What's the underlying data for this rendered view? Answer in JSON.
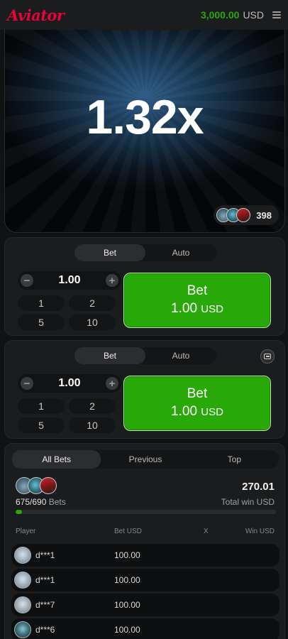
{
  "header": {
    "logo_text": "Aviator",
    "balance_amount": "3,000.00",
    "balance_currency": "USD",
    "menu_icon": "hamburger-menu-icon"
  },
  "game": {
    "multiplier": "1.32x",
    "players_online": "398"
  },
  "bet_panels": [
    {
      "tabs": [
        "Bet",
        "Auto"
      ],
      "active_tab": "Bet",
      "amount": "1.00",
      "quick_amounts": [
        "1",
        "2",
        "5",
        "10"
      ],
      "button_label": "Bet",
      "button_amount": "1.00",
      "button_currency": "USD"
    },
    {
      "tabs": [
        "Bet",
        "Auto"
      ],
      "active_tab": "Bet",
      "amount": "1.00",
      "quick_amounts": [
        "1",
        "2",
        "5",
        "10"
      ],
      "button_label": "Bet",
      "button_amount": "1.00",
      "button_currency": "USD",
      "remove_icon": "minus-box-icon"
    }
  ],
  "bets": {
    "tabs": [
      "All Bets",
      "Previous",
      "Top"
    ],
    "active_tab": "All Bets",
    "bets_count": "675/690",
    "bets_label": "Bets",
    "total_win": "270.01",
    "total_win_label": "Total win USD",
    "progress_percent": 2.5,
    "columns": [
      "Player",
      "Bet USD",
      "X",
      "Win USD"
    ],
    "rows": [
      {
        "player": "d***1",
        "bet": "100.00"
      },
      {
        "player": "d***1",
        "bet": "100.00"
      },
      {
        "player": "d***7",
        "bet": "100.00"
      },
      {
        "player": "d***6",
        "bet": "100.00"
      }
    ]
  },
  "colors": {
    "accent_green": "#28a909",
    "logo_red": "#e50539",
    "background": "#111213"
  }
}
